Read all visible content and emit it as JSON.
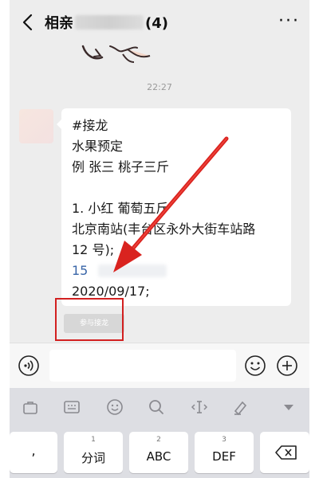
{
  "header": {
    "title_prefix": "相亲",
    "title_count": "(4)",
    "more": "···"
  },
  "chat": {
    "timestamp": "22:27",
    "message": {
      "line1": "#接龙",
      "line2": "水果预定",
      "line3": "例 张三 桃子三斤",
      "line4": "1. 小红 葡萄五斤",
      "line5": "北京南站(丰台区永外大街车站路",
      "line6": "12 号);",
      "phone": "15",
      "date": "2020/09/17;"
    },
    "join_button": "参与接龙"
  },
  "keyboard": {
    "keys": [
      {
        "num": "",
        "label": ","
      },
      {
        "num": "1",
        "label": "分词"
      },
      {
        "num": "2",
        "label": "ABC"
      },
      {
        "num": "3",
        "label": "DEF"
      }
    ]
  },
  "colors": {
    "highlight_red": "#d22020",
    "link_blue": "#3a66a8"
  }
}
